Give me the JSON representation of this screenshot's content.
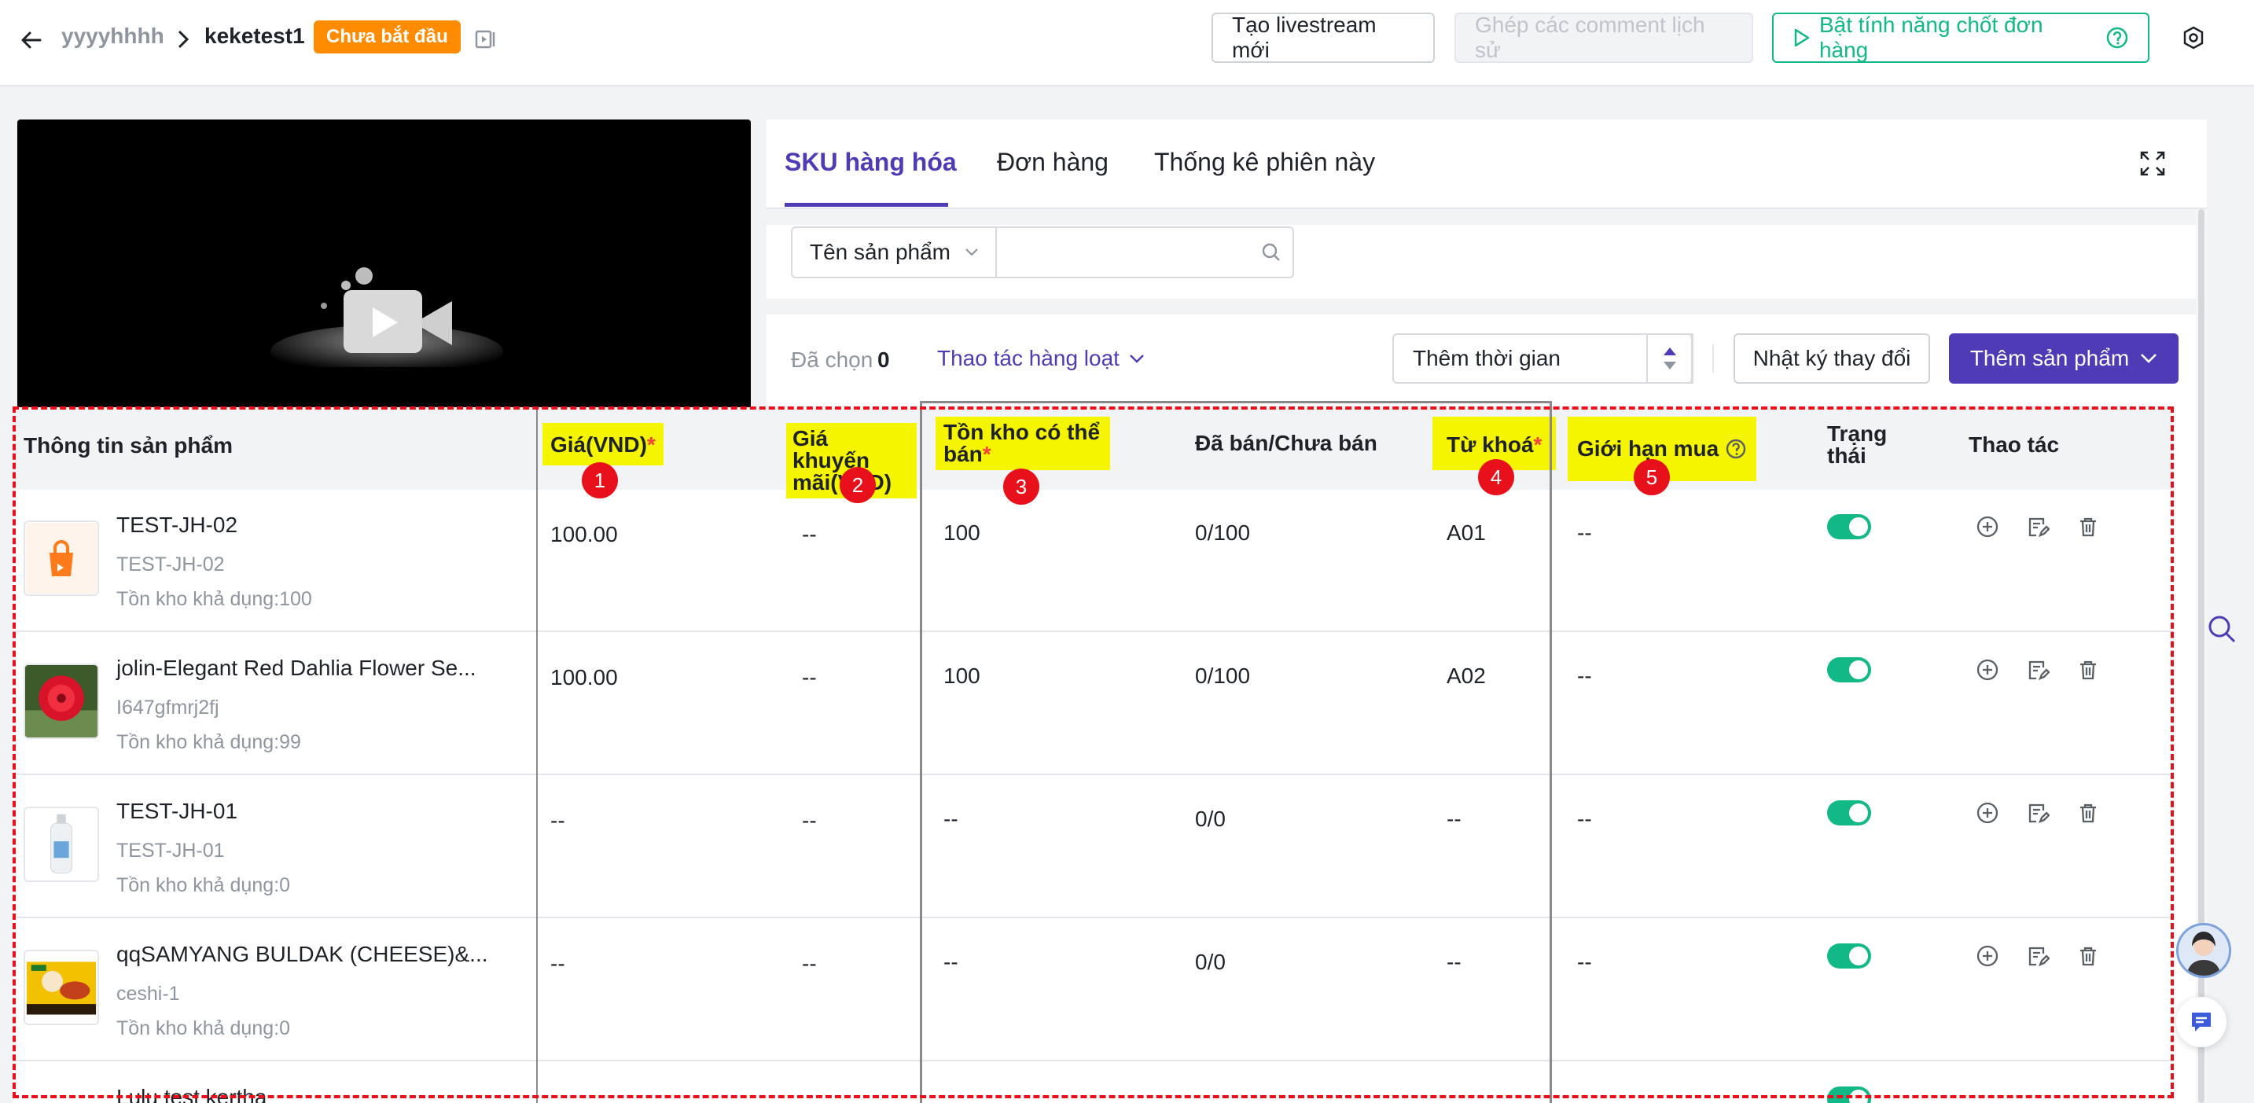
{
  "header": {
    "crumb_parent": "yyyyhhhh",
    "crumb_current": "keketest1",
    "status_badge": "Chưa bắt đầu",
    "btn_new_livestream": "Tạo livestream mới",
    "btn_merge_comments": "Ghép các comment lịch sử",
    "btn_enable_order_close": "Bật tính năng chốt đơn hàng"
  },
  "tabs": [
    "SKU hàng hóa",
    "Đơn hàng",
    "Thống kê phiên này"
  ],
  "filter": {
    "select_label": "Tên sản phẩm",
    "search_value": ""
  },
  "toolbar": {
    "selected_label": "Đã chọn",
    "selected_count": "0",
    "bulk_action": "Thao tác hàng loạt",
    "time_select": "Thêm thời gian",
    "change_log": "Nhật ký thay đổi",
    "add_product": "Thêm sản phẩm"
  },
  "table": {
    "headers": {
      "product_info": "Thông tin sản phẩm",
      "price": "Giá(VND)",
      "promo_price": "Giá khuyến mãi(VND)",
      "stock": "Tồn kho có thể bán",
      "sold": "Đã bán/Chưa bán",
      "keyword": "Từ khoá",
      "purchase_limit": "Giới hạn mua",
      "status": "Trạng thái",
      "actions": "Thao tác"
    },
    "required_mark": "*",
    "badges": [
      "1",
      "2",
      "3",
      "4",
      "5"
    ],
    "rows": [
      {
        "name": "TEST-JH-02",
        "sku": "TEST-JH-02",
        "stock_label": "Tồn kho khả dụng:100",
        "price": "100.00",
        "promo": "--",
        "stock": "100",
        "sold": "0/100",
        "keyword": "A01",
        "limit": "--",
        "enabled": true
      },
      {
        "name": "jolin-Elegant Red Dahlia Flower Se...",
        "sku": "I647gfmrj2fj",
        "stock_label": "Tồn kho khả dụng:99",
        "price": "100.00",
        "promo": "--",
        "stock": "100",
        "sold": "0/100",
        "keyword": "A02",
        "limit": "--",
        "enabled": true
      },
      {
        "name": "TEST-JH-01",
        "sku": "TEST-JH-01",
        "stock_label": "Tồn kho khả dụng:0",
        "price": "--",
        "promo": "--",
        "stock": "--",
        "sold": "0/0",
        "keyword": "--",
        "limit": "--",
        "enabled": true
      },
      {
        "name": "qqSAMYANG BULDAK (CHEESE)&...",
        "sku": "ceshi-1",
        "stock_label": "Tồn kho khả dụng:0",
        "price": "--",
        "promo": "--",
        "stock": "--",
        "sold": "0/0",
        "keyword": "--",
        "limit": "--",
        "enabled": true
      },
      {
        "name": "Lulu test kertha",
        "sku": "",
        "stock_label": "",
        "price": "",
        "promo": "",
        "stock": "",
        "sold": "",
        "keyword": "",
        "limit": "",
        "enabled": true
      }
    ]
  },
  "colors": {
    "accent": "#4e3bb5",
    "success": "#12b886",
    "badge": "#ff8b00",
    "annotation": "#e8101a",
    "highlight": "#f5f500"
  }
}
